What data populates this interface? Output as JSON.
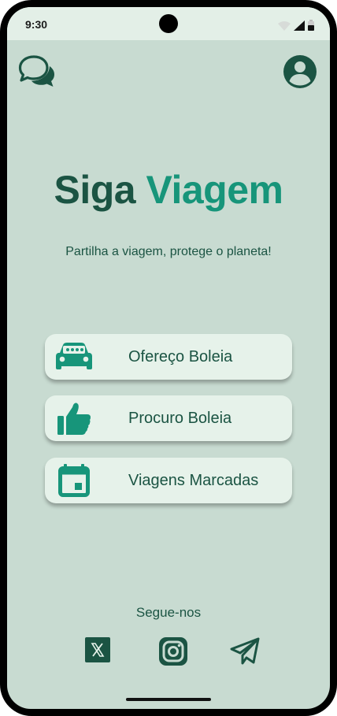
{
  "status_bar": {
    "time": "9:30"
  },
  "header": {
    "chat_icon": "chat-bubbles-icon",
    "profile_icon": "account-circle-icon"
  },
  "brand": {
    "word1": "Siga",
    "word2": "Viagem"
  },
  "tagline": "Partilha a viagem, protege o planeta!",
  "actions": [
    {
      "label": "Ofereço Boleia",
      "icon": "car-icon"
    },
    {
      "label": "Procuro Boleia",
      "icon": "thumbs-up-icon"
    },
    {
      "label": "Viagens Marcadas",
      "icon": "calendar-icon"
    }
  ],
  "footer": {
    "follow_label": "Segue-nos",
    "social": [
      "x-icon",
      "instagram-icon",
      "telegram-icon"
    ]
  },
  "colors": {
    "background": "#c8dbd1",
    "dark_green": "#1b5443",
    "accent_green": "#17957a",
    "button_bg": "#e6f2ea"
  }
}
